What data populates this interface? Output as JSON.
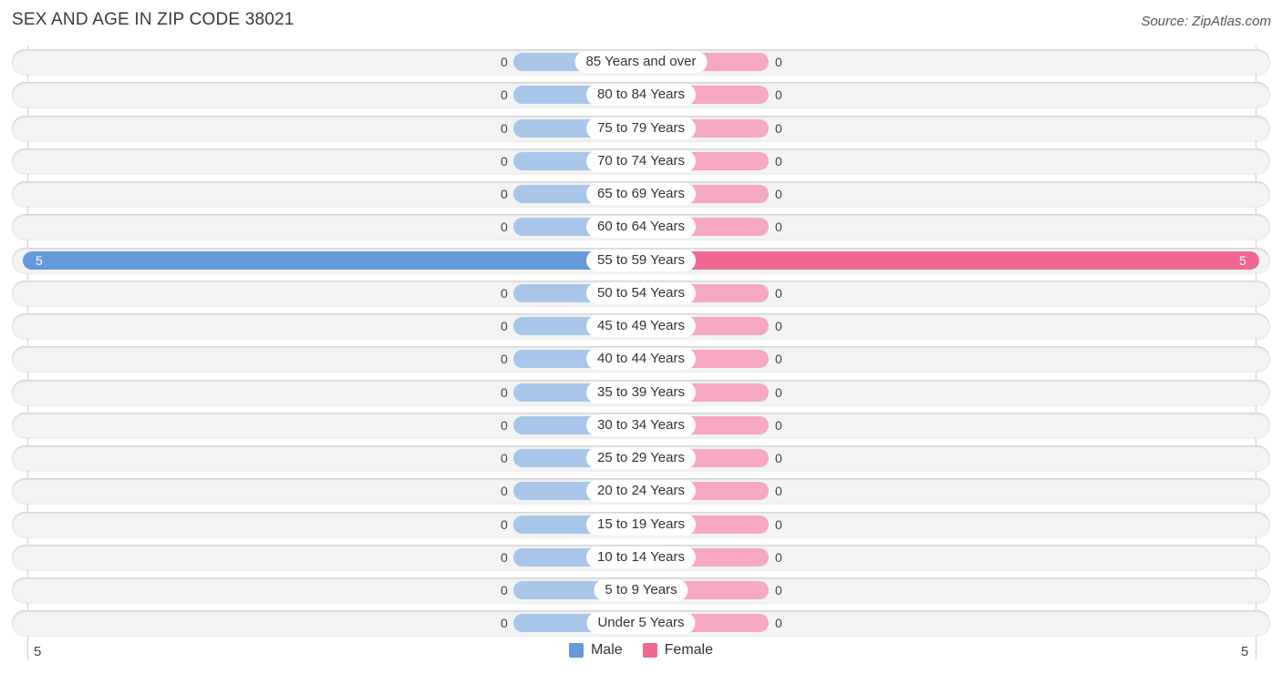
{
  "header": {
    "title": "SEX AND AGE IN ZIP CODE 38021",
    "source": "Source: ZipAtlas.com"
  },
  "chart_data": {
    "type": "bar",
    "orientation": "horizontal-diverging",
    "title": "SEX AND AGE IN ZIP CODE 38021",
    "categories": [
      "85 Years and over",
      "80 to 84 Years",
      "75 to 79 Years",
      "70 to 74 Years",
      "65 to 69 Years",
      "60 to 64 Years",
      "55 to 59 Years",
      "50 to 54 Years",
      "45 to 49 Years",
      "40 to 44 Years",
      "35 to 39 Years",
      "30 to 34 Years",
      "25 to 29 Years",
      "20 to 24 Years",
      "15 to 19 Years",
      "10 to 14 Years",
      "5 to 9 Years",
      "Under 5 Years"
    ],
    "series": [
      {
        "name": "Male",
        "color": "#6599d9",
        "stub_color": "#a8c6ea",
        "values": [
          0,
          0,
          0,
          0,
          0,
          0,
          5,
          0,
          0,
          0,
          0,
          0,
          0,
          0,
          0,
          0,
          0,
          0
        ]
      },
      {
        "name": "Female",
        "color": "#f06892",
        "stub_color": "#f5a8c0",
        "values": [
          0,
          0,
          0,
          0,
          0,
          0,
          5,
          0,
          0,
          0,
          0,
          0,
          0,
          0,
          0,
          0,
          0,
          0
        ]
      }
    ],
    "xlim": [
      5,
      5
    ],
    "axis_ticks": {
      "left": "5",
      "right": "5"
    },
    "legend": {
      "position": "bottom-center",
      "entries": [
        "Male",
        "Female"
      ]
    },
    "grid": false
  }
}
